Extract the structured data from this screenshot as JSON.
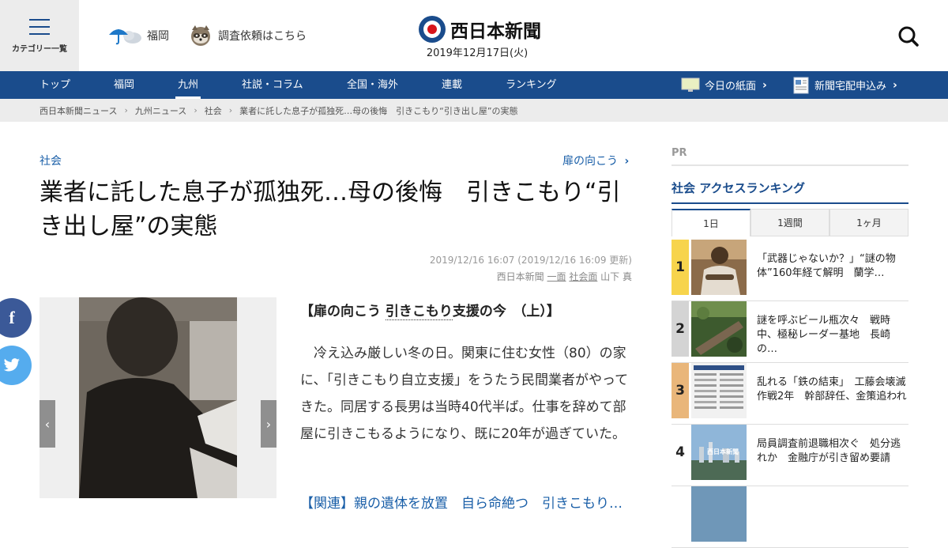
{
  "header": {
    "category_label": "カテゴリー一覧",
    "weather_label": "福岡",
    "request_label": "調査依頼はこちら",
    "logo_text": "西日本新聞",
    "date": "2019年12月17日(火)"
  },
  "nav": {
    "items": [
      "トップ",
      "福岡",
      "九州",
      "社説・コラム",
      "全国・海外",
      "連載",
      "ランキング"
    ],
    "active": "九州",
    "todays_paper": "今日の紙面",
    "subscribe": "新聞宅配申込み"
  },
  "breadcrumb": [
    "西日本新聞ニュース",
    "九州ニュース",
    "社会",
    "業者に託した息子が孤独死…母の後悔　引きこもり“引き出し屋”の実態"
  ],
  "article": {
    "category": "社会",
    "series": "扉の向こう",
    "title": "業者に託した息子が孤独死…母の後悔　引きこもり“引き出し屋”の実態",
    "timestamp": "2019/12/16 16:07 (2019/12/16 16:09 更新)",
    "source": "西日本新聞",
    "page1": "一面",
    "page2": "社会面",
    "author": "山下 真",
    "lede_prefix": "【扉の向こう ",
    "lede_link": "引きこもり",
    "lede_suffix": "支援の今　（上）】",
    "body": "冷え込み厳しい冬の日。関東に住む女性（80）の家に、「引きこもり自立支援」をうたう民間業者がやってきた。同居する長男は当時40代半ば。仕事を辞めて部屋に引きこもるようになり、既に20年が過ぎていた。",
    "related": "【関連】親の遺体を放置　自ら命絶つ　引きこもり…"
  },
  "sidebar": {
    "pr": "PR",
    "ranking_title": "社会 アクセスランキング",
    "tabs": [
      "1日",
      "1週間",
      "1ヶ月"
    ],
    "items": [
      {
        "rank": "1",
        "text": "「武器じゃないか？」“謎の物体”160年経て解明　蘭学…"
      },
      {
        "rank": "2",
        "text": "謎を呼ぶビール瓶次々　戦時中、極秘レーダー基地　長崎の…"
      },
      {
        "rank": "3",
        "text": "乱れる「鉄の結束」　工藤会壊滅作戦2年　幹部辞任、金策追われ"
      },
      {
        "rank": "4",
        "text": "局員調査前退職相次ぐ　処分逃れか　金融庁が引き留め要請"
      }
    ],
    "thumb4_logo": "西日本新聞"
  },
  "colors": {
    "brand": "#1a4c8c",
    "link": "#1a5fa8",
    "rank1": "#f7d44c",
    "rank2": "#d4d4d4",
    "rank3": "#e9b67a",
    "facebook": "#3b5998",
    "twitter": "#55acee"
  }
}
